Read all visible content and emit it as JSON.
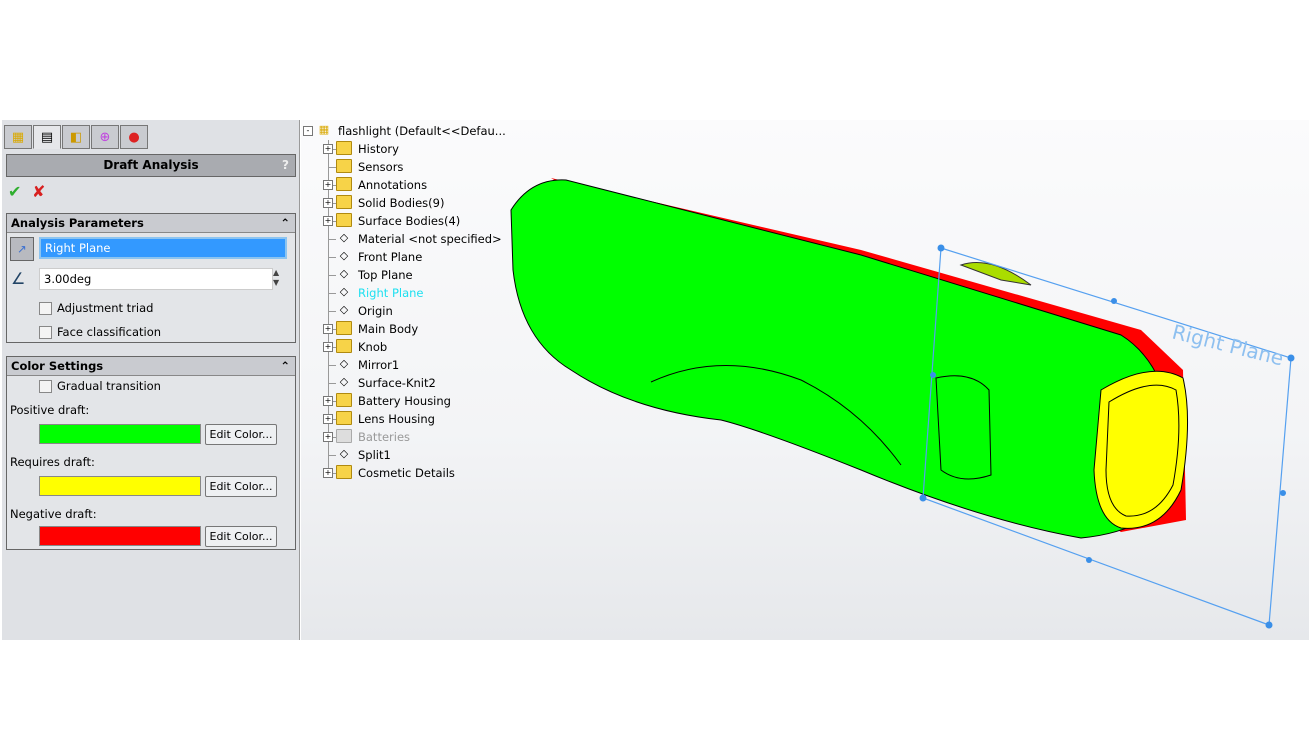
{
  "panel": {
    "tabs": [
      {
        "icon": "feature-manager-icon"
      },
      {
        "icon": "property-manager-icon"
      },
      {
        "icon": "configuration-manager-icon"
      },
      {
        "icon": "dimxpert-icon"
      },
      {
        "icon": "display-manager-icon"
      }
    ],
    "title": "Draft Analysis",
    "help": "?",
    "analysis_parameters": {
      "header": "Analysis Parameters",
      "direction": "Right Plane",
      "angle": "3.00deg",
      "adjustment_triad": "Adjustment triad",
      "face_classification": "Face classification"
    },
    "color_settings": {
      "header": "Color Settings",
      "gradual_transition": "Gradual transition",
      "positive_label": "Positive draft:",
      "positive_color": "#00ff00",
      "requires_label": "Requires draft:",
      "requires_color": "#ffff00",
      "negative_label": "Negative draft:",
      "negative_color": "#ff0000",
      "edit_color": "Edit Color..."
    }
  },
  "tree": {
    "root": "flashlight  (Default<<Defau...",
    "items": [
      {
        "label": "History",
        "expand": true
      },
      {
        "label": "Sensors",
        "expand": false
      },
      {
        "label": "Annotations",
        "expand": true
      },
      {
        "label": "Solid Bodies(9)",
        "expand": true
      },
      {
        "label": "Surface Bodies(4)",
        "expand": true
      },
      {
        "label": "Material <not specified>",
        "expand": false
      },
      {
        "label": "Front Plane",
        "expand": false
      },
      {
        "label": "Top Plane",
        "expand": false
      },
      {
        "label": "Right Plane",
        "expand": false,
        "selected": true
      },
      {
        "label": "Origin",
        "expand": false
      },
      {
        "label": "Main Body",
        "expand": true
      },
      {
        "label": "Knob",
        "expand": true
      },
      {
        "label": "Mirror1",
        "expand": false
      },
      {
        "label": "Surface-Knit2",
        "expand": false
      },
      {
        "label": "Battery Housing",
        "expand": true
      },
      {
        "label": "Lens Housing",
        "expand": true
      },
      {
        "label": "Batteries",
        "expand": true,
        "disabled": true
      },
      {
        "label": "Split1",
        "expand": false
      },
      {
        "label": "Cosmetic Details",
        "expand": true
      }
    ]
  },
  "viewport": {
    "plane_label": "Right Plane"
  }
}
